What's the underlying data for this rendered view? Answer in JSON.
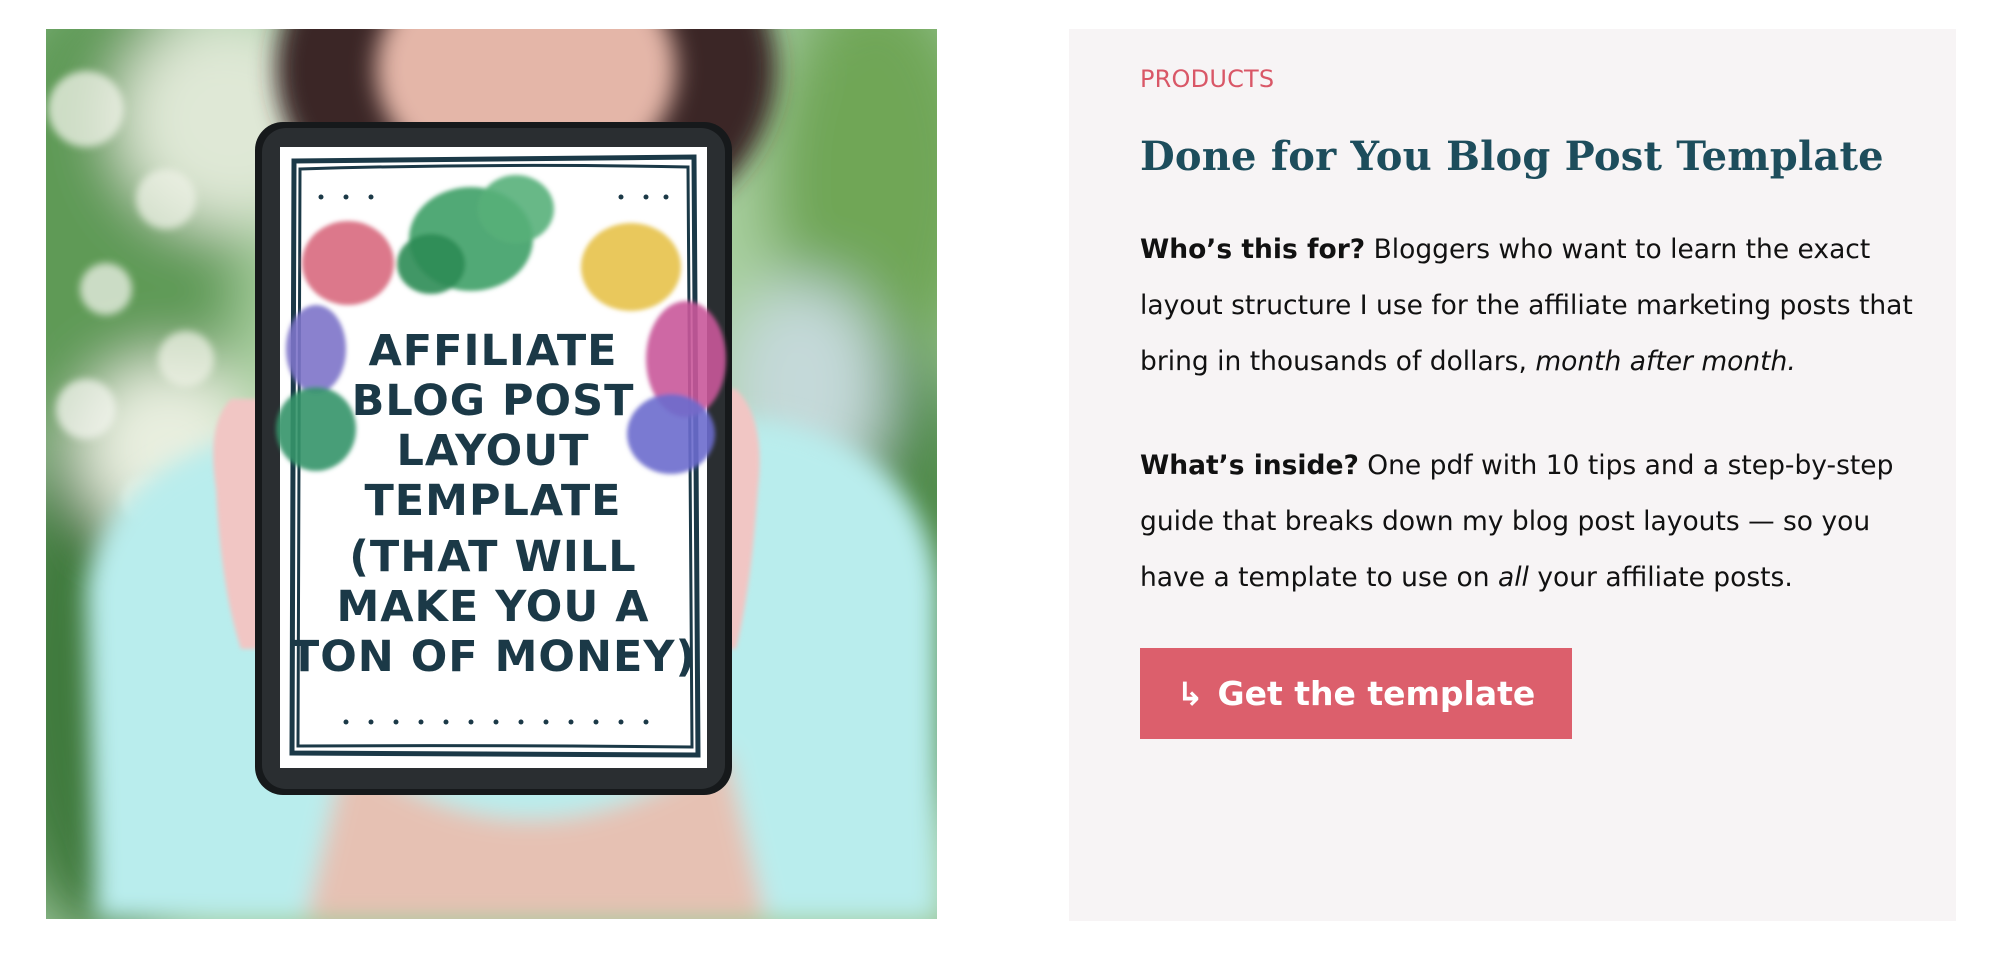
{
  "image": {
    "alt": "AFFILIATE BLOG POST LAYOUT TEMPLATE (THAT WILL MAKE YOU A TON OF MONEY)",
    "tablet_lines": [
      "AFFILIATE",
      "BLOG POST",
      "LAYOUT",
      "TEMPLATE",
      "(THAT WILL",
      "MAKE YOU A",
      "TON OF MONEY)"
    ]
  },
  "card": {
    "category": "PRODUCTS",
    "title": "Done for You Blog Post Template",
    "who": {
      "label": "Who’s this for?",
      "text": " Bloggers who want to learn the exact layout structure I use for the affiliate marketing posts that bring in thousands of dollars, ",
      "emphasis": "month after month."
    },
    "inside": {
      "label": "What’s inside?",
      "text": " One pdf with 10 tips and a step-by-step guide that breaks down my blog post layouts — so you have a template to use on ",
      "emphasis": "all",
      "text_end": " your affiliate posts."
    },
    "cta": {
      "arrow": "↳",
      "label": "Get the template"
    }
  },
  "colors": {
    "accent": "#dc5f6c",
    "category": "#d95767",
    "title": "#1d4d5c",
    "card_bg": "#f7f4f5",
    "tablet_text": "#1b3947"
  }
}
